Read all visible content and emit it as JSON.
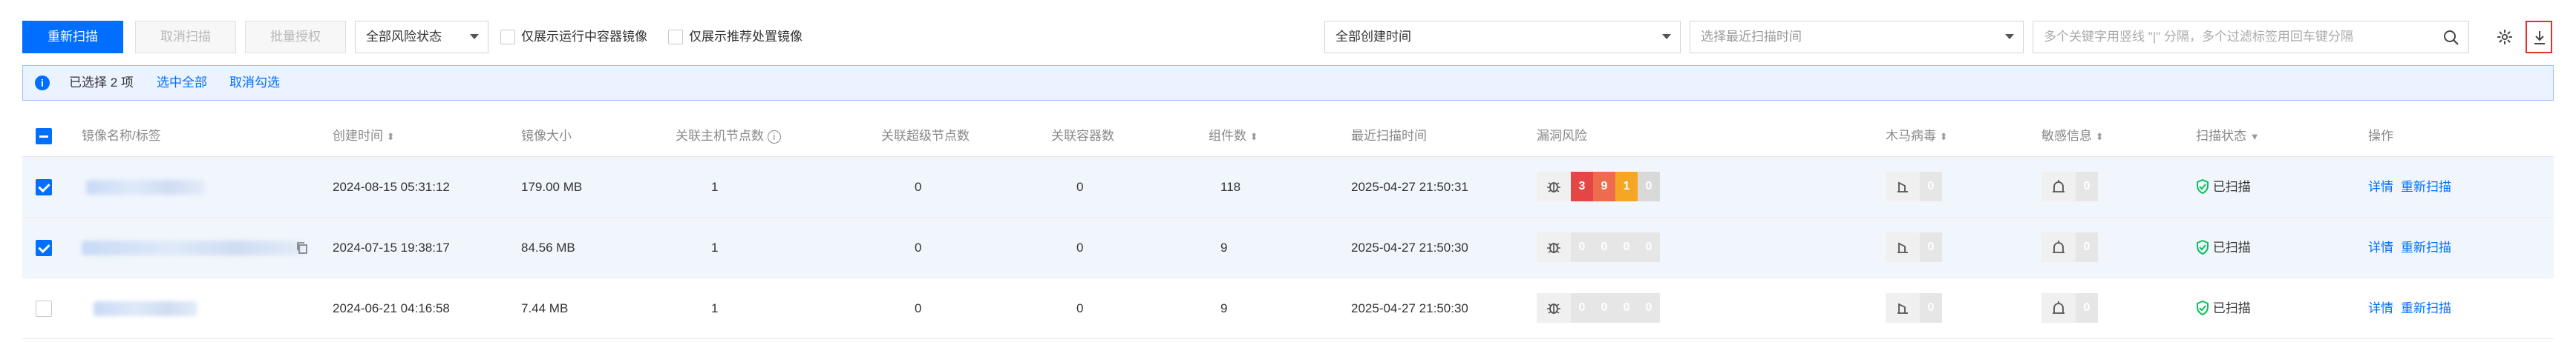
{
  "toolbar": {
    "rescan": "重新扫描",
    "cancel_scan": "取消扫描",
    "batch_auth": "批量授权",
    "risk_filter": "全部风险状态",
    "only_running_label": "仅展示运行中容器镜像",
    "only_recommended_label": "仅展示推荐处置镜像",
    "create_time_filter": "全部创建时间",
    "last_scan_placeholder": "选择最近扫描时间",
    "search_placeholder": "多个关键字用竖线 \"|\" 分隔，多个过滤标签用回车键分隔"
  },
  "selection": {
    "selected_text": "已选择 2 项",
    "select_all": "选中全部",
    "cancel_select": "取消勾选"
  },
  "columns": {
    "name": "镜像名称/标签",
    "created": "创建时间",
    "size": "镜像大小",
    "host_nodes": "关联主机节点数",
    "super_nodes": "关联超级节点数",
    "containers": "关联容器数",
    "components": "组件数",
    "last_scan": "最近扫描时间",
    "vuln": "漏洞风险",
    "trojan": "木马病毒",
    "sensitive": "敏感信息",
    "scan_status": "扫描状态",
    "ops": "操作"
  },
  "rows": [
    {
      "selected": true,
      "created": "2024-08-15 05:31:12",
      "size": "179.00 MB",
      "host_nodes": "1",
      "super_nodes": "0",
      "containers": "0",
      "components": "118",
      "last_scan": "2025-04-27 21:50:31",
      "vuln": [
        "3",
        "9",
        "1",
        "0"
      ],
      "trojan": "0",
      "sensitive": "0",
      "status": "已扫描",
      "op_detail": "详情",
      "op_rescan": "重新扫描"
    },
    {
      "selected": true,
      "created": "2024-07-15 19:38:17",
      "size": "84.56 MB",
      "host_nodes": "1",
      "super_nodes": "0",
      "containers": "0",
      "components": "9",
      "last_scan": "2025-04-27 21:50:30",
      "vuln": [
        "0",
        "0",
        "0",
        "0"
      ],
      "trojan": "0",
      "sensitive": "0",
      "status": "已扫描",
      "op_detail": "详情",
      "op_rescan": "重新扫描"
    },
    {
      "selected": false,
      "created": "2024-06-21 04:16:58",
      "size": "7.44 MB",
      "host_nodes": "1",
      "super_nodes": "0",
      "containers": "0",
      "components": "9",
      "last_scan": "2025-04-27 21:50:30",
      "vuln": [
        "0",
        "0",
        "0",
        "0"
      ],
      "trojan": "0",
      "sensitive": "0",
      "status": "已扫描",
      "op_detail": "详情",
      "op_rescan": "重新扫描"
    }
  ],
  "colors": {
    "primary": "#006eff",
    "critical": "#e54545",
    "high": "#ee6b4d",
    "medium": "#f5a623",
    "scanned": "#0abf5b"
  }
}
